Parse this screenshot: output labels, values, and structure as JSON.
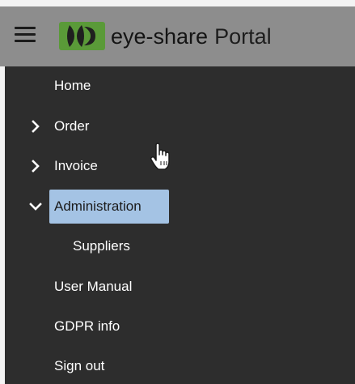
{
  "header": {
    "brand_name": "eye-share",
    "product": "Portal",
    "logo_icon": "eye-share-logo-icon",
    "menu_icon": "hamburger-menu-icon",
    "colors": {
      "header_bg": "#8d8d8d",
      "logo_green": "#5a9a38",
      "sidebar_bg": "#2d2d2d",
      "active_bg": "#a4c3e4"
    }
  },
  "sidebar": {
    "items": [
      {
        "label": "Home",
        "expandable": false
      },
      {
        "label": "Order",
        "expandable": true,
        "expanded": false
      },
      {
        "label": "Invoice",
        "expandable": true,
        "expanded": false
      },
      {
        "label": "Administration",
        "expandable": true,
        "expanded": true,
        "active": true
      },
      {
        "label": "Suppliers",
        "sub": true
      },
      {
        "label": "User Manual",
        "expandable": false
      },
      {
        "label": "GDPR info",
        "expandable": false
      },
      {
        "label": "Sign out",
        "expandable": false
      }
    ]
  }
}
